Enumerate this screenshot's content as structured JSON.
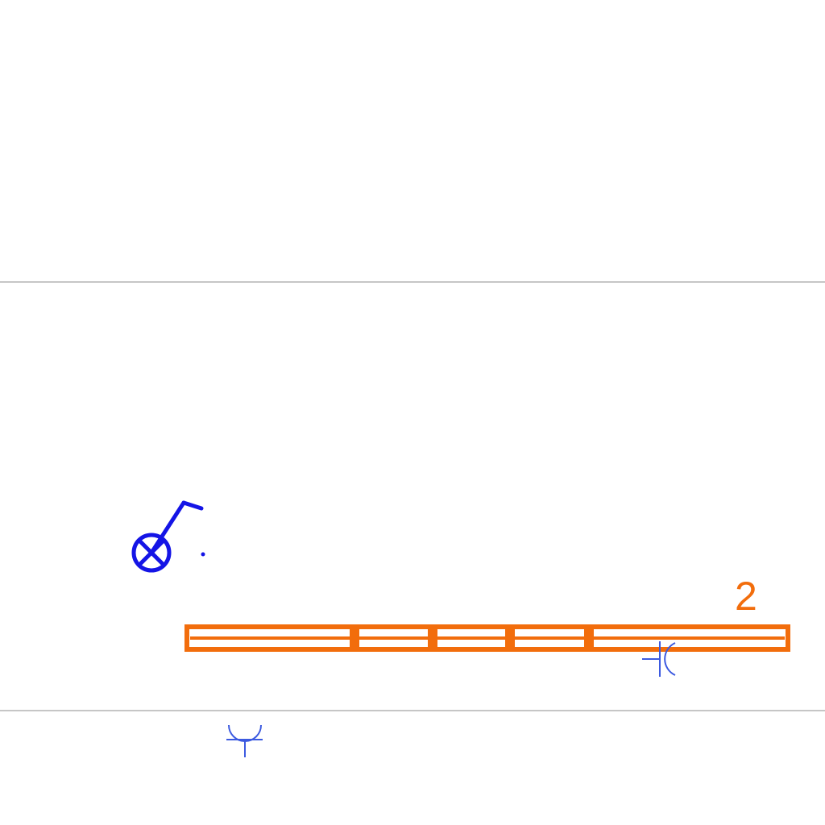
{
  "colors": {
    "background": "#ffffff",
    "line": "#b4b4b4",
    "orange": "#f26d0c",
    "blue": "#1414e6",
    "light_blue": "#3c5ae0"
  },
  "labels": {
    "segment_number": "2"
  },
  "icons": {
    "lamp_symbol": "lamp-post-icon",
    "outlet_symbol_right": "socket-symbol-icon",
    "outlet_symbol_bottom": "socket-symbol-icon"
  }
}
